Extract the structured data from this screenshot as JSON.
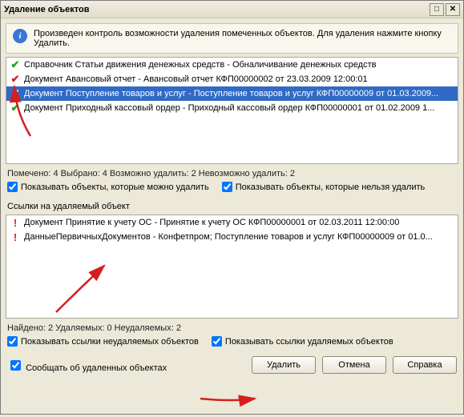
{
  "window": {
    "title": "Удаление объектов"
  },
  "info": {
    "text": "Произведен контроль возможности удаления помеченных объектов. Для удаления нажмите кнопку Удалить."
  },
  "list": {
    "items": [
      {
        "status": "ok",
        "text": "Справочник Статьи движения денежных средств - Обналичивание денежных средств"
      },
      {
        "status": "bad",
        "text": "Документ Авансовый отчет - Авансовый отчет КФП00000002 от 23.03.2009 12:00:01"
      },
      {
        "status": "bad",
        "text": "Документ Поступление товаров и услуг - Поступление товаров и услуг КФП00000009 от 01.03.2009...",
        "selected": true
      },
      {
        "status": "ok",
        "text": "Документ Приходный кассовый ордер - Приходный кассовый ордер КФП00000001 от 01.02.2009 1..."
      }
    ]
  },
  "summary1": {
    "text": "Помечено: 4  Выбрано: 4  Возможно удалить: 2  Невозможно удалить: 2",
    "cb_can_delete": "Показывать объекты, которые можно удалить",
    "cb_cannot_delete": "Показывать объекты, которые нельзя удалить"
  },
  "refs": {
    "title": "Ссылки на удаляемый объект",
    "items": [
      {
        "text": "Документ Принятие к учету ОС - Принятие к учету ОС КФП00000001 от 02.03.2011 12:00:00"
      },
      {
        "text": "ДанныеПервичныхДокументов  - Конфетпром; Поступление товаров и услуг КФП00000009 от 01.0..."
      }
    ]
  },
  "summary2": {
    "text": "Найдено: 2  Удаляемых: 0  Неудаляемых: 2",
    "cb_nondel": "Показывать ссылки неудаляемых объектов",
    "cb_del": "Показывать ссылки удаляемых объектов",
    "cb_report": "Сообщать об удаленных объектах"
  },
  "buttons": {
    "delete": "Удалить",
    "cancel": "Отмена",
    "help": "Справка"
  }
}
